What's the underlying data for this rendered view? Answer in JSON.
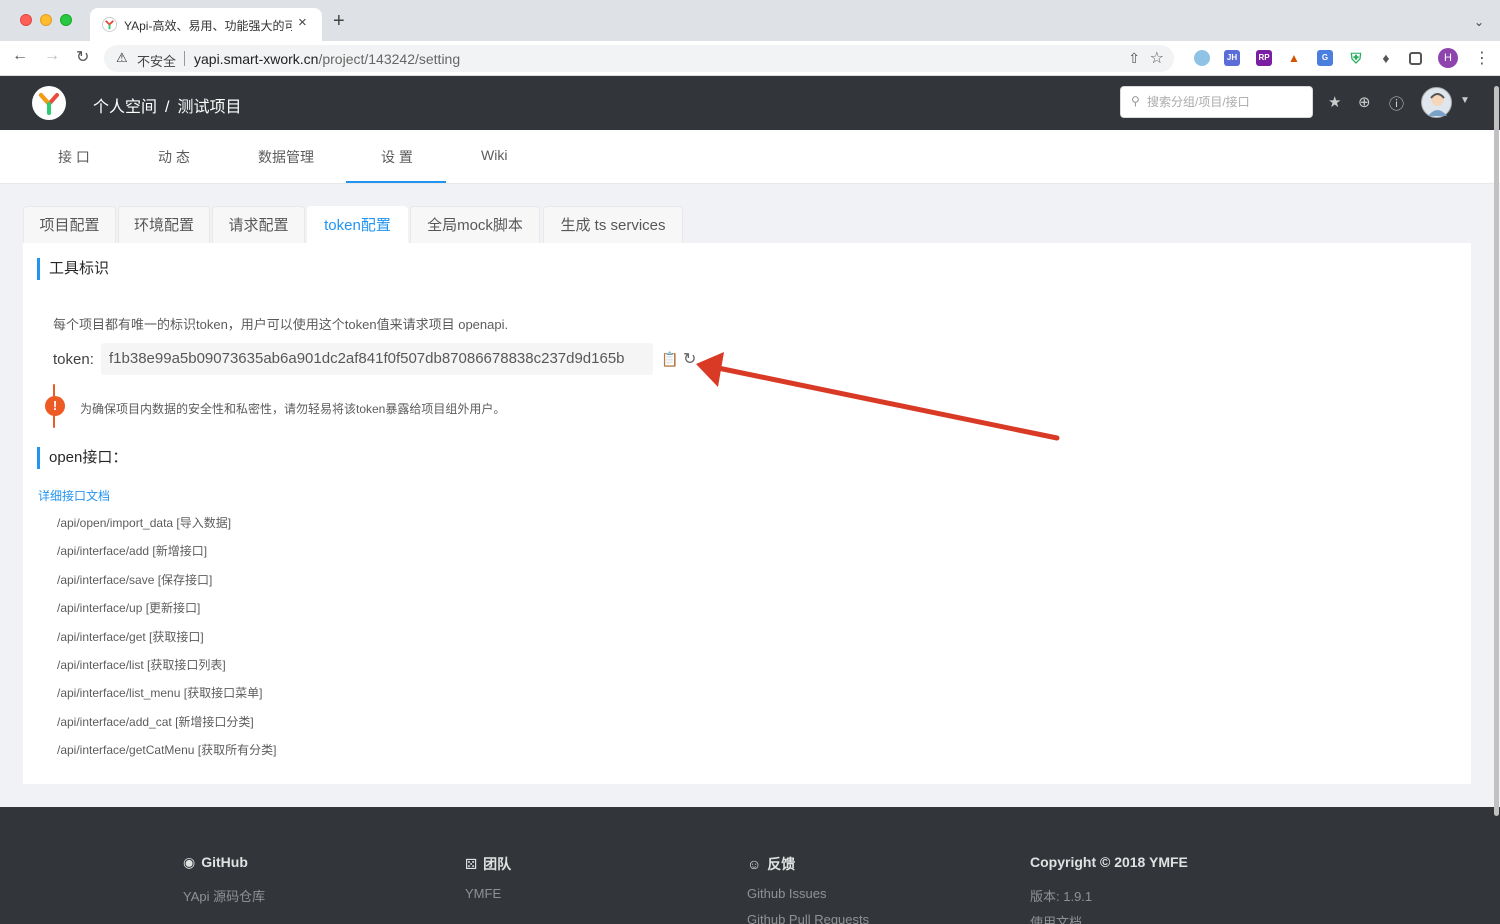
{
  "browser": {
    "tab_title": "YApi-高效、易用、功能强大的可",
    "close_glyph": "×",
    "new_tab_glyph": "+",
    "insecure_label": "不安全",
    "url_host": "yapi.smart-xwork.cn",
    "url_path": "/project/143242/setting",
    "profile_initial": "H",
    "extensions": [
      "circle-ext",
      "JH",
      "RP",
      "tree-ext",
      "translate-ext",
      "shield-ext",
      "puzzle-ext"
    ]
  },
  "header": {
    "space": "个人空间",
    "separator": "/",
    "project": "测试项目",
    "search_placeholder": "搜索分组/项目/接口"
  },
  "subnav": {
    "items": [
      {
        "label": "接 口"
      },
      {
        "label": "动 态"
      },
      {
        "label": "数据管理"
      },
      {
        "label": "设 置"
      },
      {
        "label": "Wiki"
      }
    ],
    "active_index": 3
  },
  "settings_tabs": [
    {
      "label": "项目配置"
    },
    {
      "label": "环境配置"
    },
    {
      "label": "请求配置"
    },
    {
      "label": "token配置"
    },
    {
      "label": "全局mock脚本"
    },
    {
      "label": "生成 ts services"
    }
  ],
  "token_section": {
    "title": "工具标识",
    "description": "每个项目都有唯一的标识token，用户可以使用这个token值来请求项目 openapi.",
    "token_label": "token:",
    "token_value": "f1b38e99a5b09073635ab6a901dc2af841f0f507db87086678838c237d9d165b",
    "alert_mark": "!",
    "warning": "为确保项目内数据的安全性和私密性，请勿轻易将该token暴露给项目组外用户。"
  },
  "open_section": {
    "title": "open接口：",
    "doc_link": "详细接口文档",
    "apis": [
      "/api/open/import_data [导入数据]",
      "/api/interface/add [新增接口]",
      "/api/interface/save [保存接口]",
      "/api/interface/up [更新接口]",
      "/api/interface/get [获取接口]",
      "/api/interface/list [获取接口列表]",
      "/api/interface/list_menu [获取接口菜单]",
      "/api/interface/add_cat [新增接口分类]",
      "/api/interface/getCatMenu [获取所有分类]"
    ]
  },
  "footer": {
    "columns": [
      {
        "icon": "github-icon",
        "title": "GitHub",
        "links": [
          "YApi 源码仓库"
        ]
      },
      {
        "icon": "team-icon",
        "title": "团队",
        "links": [
          "YMFE"
        ]
      },
      {
        "icon": "feedback-icon",
        "title": "反馈",
        "links": [
          "Github Issues",
          "Github Pull Requests"
        ]
      },
      {
        "icon": "",
        "title": "Copyright © 2018 YMFE",
        "links": [
          "版本: 1.9.1",
          "使用文档"
        ]
      }
    ]
  },
  "colors": {
    "accent": "#2395f1",
    "header_bg": "#32363a",
    "warning": "#ee5a24",
    "annotation_arrow": "#d93a26"
  }
}
